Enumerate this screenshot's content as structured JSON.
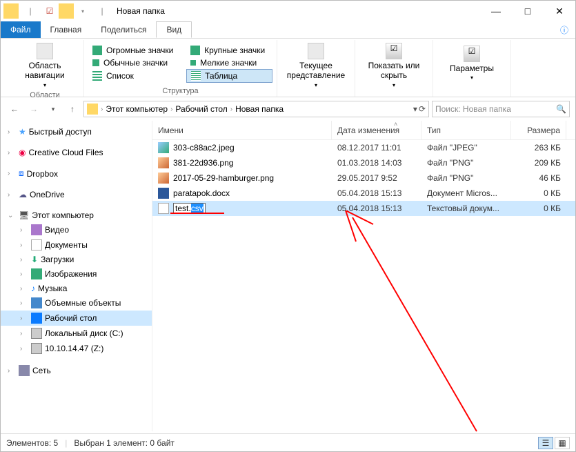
{
  "titlebar": {
    "title": "Новая папка"
  },
  "tabs": {
    "file": "Файл",
    "home": "Главная",
    "share": "Поделиться",
    "view": "Вид"
  },
  "ribbon": {
    "nav_pane": "Область навигации",
    "panels_label": "Области",
    "views": {
      "huge": "Огромные значки",
      "large": "Крупные значки",
      "normal": "Обычные значки",
      "small": "Мелкие значки",
      "list": "Список",
      "table": "Таблица"
    },
    "structure_label": "Структура",
    "current_view": "Текущее представление",
    "show_hide": "Показать или скрыть",
    "options": "Параметры"
  },
  "breadcrumb": {
    "pc": "Этот компьютер",
    "desktop": "Рабочий стол",
    "folder": "Новая папка"
  },
  "search": {
    "placeholder": "Поиск: Новая папка"
  },
  "sidebar": {
    "quick": "Быстрый доступ",
    "ccf": "Creative Cloud Files",
    "dropbox": "Dropbox",
    "onedrive": "OneDrive",
    "pc": "Этот компьютер",
    "video": "Видео",
    "documents": "Документы",
    "downloads": "Загрузки",
    "images": "Изображения",
    "music": "Музыка",
    "objects3d": "Объемные объекты",
    "desktop": "Рабочий стол",
    "localdisk": "Локальный диск (C:)",
    "netdrive": "10.10.14.47 (Z:)",
    "network": "Сеть"
  },
  "columns": {
    "name": "Имени",
    "date": "Дата изменения",
    "type": "Тип",
    "size": "Размера"
  },
  "files": [
    {
      "name": "303-c88ac2.jpeg",
      "date": "08.12.2017 11:01",
      "type": "Файл \"JPEG\"",
      "size": "263 КБ"
    },
    {
      "name": "381-22d936.png",
      "date": "01.03.2018 14:03",
      "type": "Файл \"PNG\"",
      "size": "209 КБ"
    },
    {
      "name": "2017-05-29-hamburger.png",
      "date": "29.05.2017 9:52",
      "type": "Файл \"PNG\"",
      "size": "46 КБ"
    },
    {
      "name": "paratapok.docx",
      "date": "05.04.2018 15:13",
      "type": "Документ Micros...",
      "size": "0 КБ"
    },
    {
      "name_editing": "test.",
      "name_ext": "csv",
      "date": "05.04.2018 15:13",
      "type": "Текстовый докум...",
      "size": "0 КБ"
    }
  ],
  "status": {
    "count": "Элементов: 5",
    "selection": "Выбран 1 элемент: 0 байт"
  }
}
